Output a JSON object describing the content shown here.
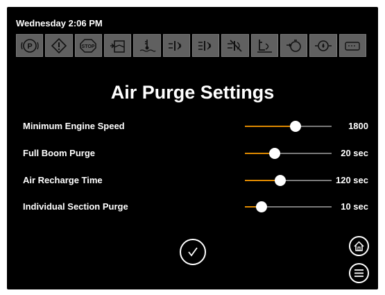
{
  "status": {
    "datetime": "Wednesday 2:06 PM"
  },
  "icon_bar": [
    {
      "name": "parking-brake-icon"
    },
    {
      "name": "warning-icon"
    },
    {
      "name": "stop-icon",
      "label": "STOP"
    },
    {
      "name": "tank-level-icon"
    },
    {
      "name": "coolant-temp-icon"
    },
    {
      "name": "boom-left-icon"
    },
    {
      "name": "boom-sections-icon"
    },
    {
      "name": "boom-off-icon"
    },
    {
      "name": "boom-height-icon"
    },
    {
      "name": "engine-oil-icon"
    },
    {
      "name": "oil-pressure-icon"
    },
    {
      "name": "message-icon"
    }
  ],
  "page": {
    "title": "Air Purge Settings"
  },
  "settings": [
    {
      "label": "Minimum Engine Speed",
      "value": "1800",
      "level": 0.58
    },
    {
      "label": "Full Boom Purge",
      "value": "20 sec",
      "level": 0.34
    },
    {
      "label": "Air Recharge Time",
      "value": "120 sec",
      "level": 0.41
    },
    {
      "label": "Individual Section Purge",
      "value": "10 sec",
      "level": 0.19
    }
  ],
  "colors": {
    "accent": "#e08a00",
    "background": "#000000",
    "icon_tile": "#606060"
  },
  "actions": {
    "confirm": "check-icon",
    "home": "home-icon",
    "menu": "menu-icon"
  }
}
